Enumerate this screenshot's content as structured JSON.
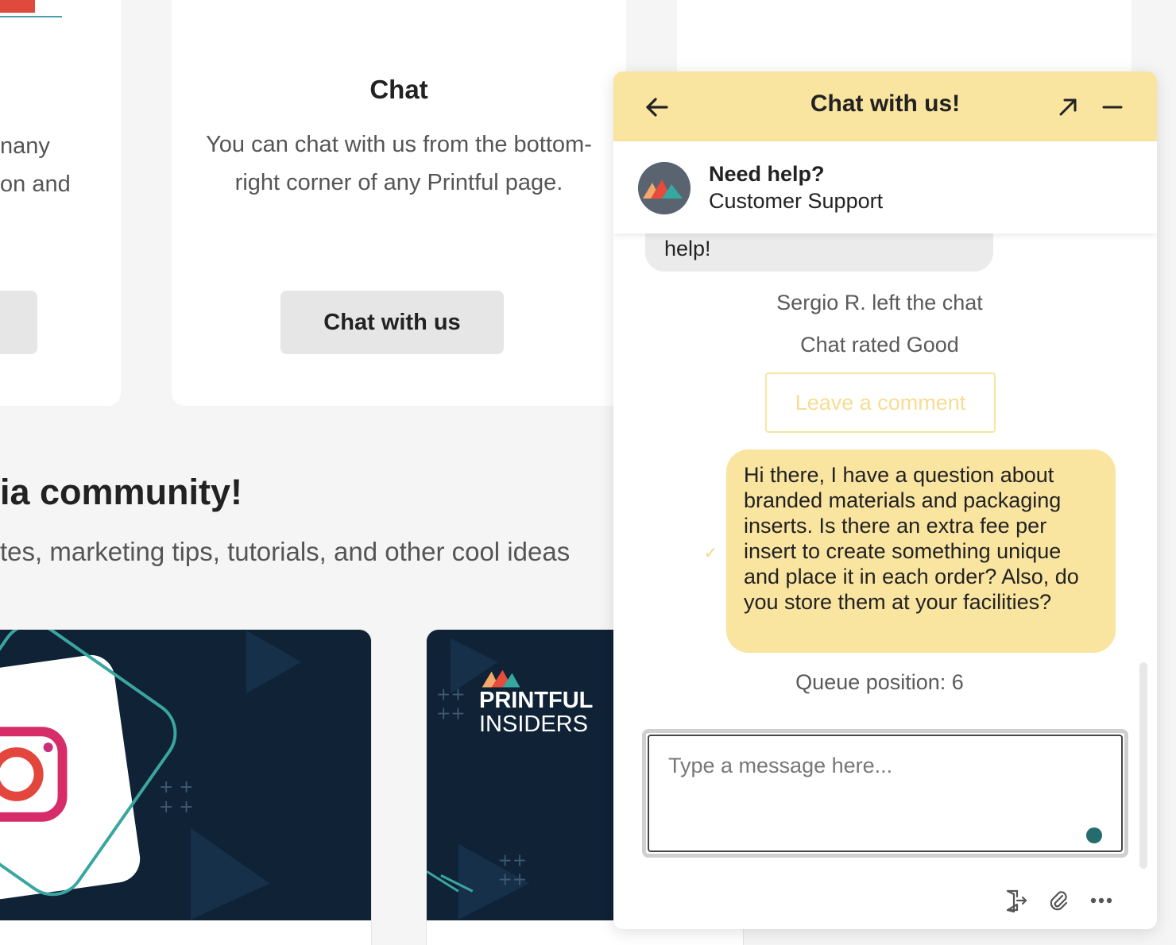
{
  "background": {
    "left_card": {
      "text_line1": "nany",
      "text_line2": "on and"
    },
    "chat_card": {
      "title": "Chat",
      "description": "You can chat with us from the bottom-right corner of any Printful page.",
      "button_label": "Chat with us"
    },
    "community": {
      "title": "ia community!",
      "subtitle": "tes, marketing tips, tutorials, and other cool ideas"
    },
    "insiders_card": {
      "line1": "PRINTFUL",
      "line2": "INSIDERS"
    }
  },
  "widget": {
    "title": "Chat with us!",
    "agent": {
      "name": "Need help?",
      "role": "Customer Support"
    },
    "messages": {
      "agent_tail": "help!",
      "left_notice": "Sergio R. left the chat",
      "rated_notice": "Chat rated Good",
      "leave_comment_label": "Leave a comment",
      "user_message": "Hi there, I have a question about branded materials and packaging inserts. Is there an extra fee per insert to create something unique and place it in each order? Also, do you store them at your facilities?",
      "queue_notice": "Queue position: 6"
    },
    "input": {
      "placeholder": "Type a message here...",
      "value": ""
    },
    "icons": {
      "back": "arrow-left-icon",
      "expand": "expand-icon",
      "minimize": "minimize-icon",
      "exit": "exit-icon",
      "attach": "paperclip-icon",
      "more": "more-icon"
    }
  },
  "colors": {
    "header": "#f9e4a0",
    "user_bubble": "#f9e4a0",
    "agent_bubble": "#ebebeb",
    "typing_dot": "#256c6d",
    "media_card_bg": "#0f2236"
  }
}
